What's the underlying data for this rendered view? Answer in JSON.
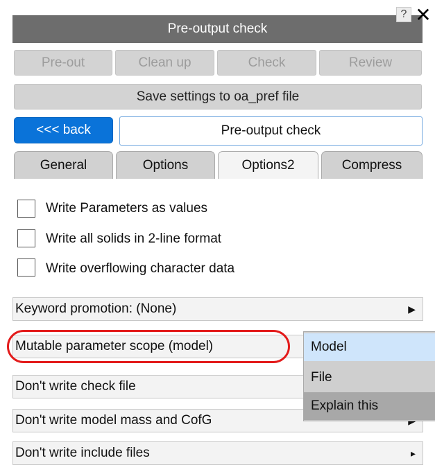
{
  "window": {
    "title": "Pre-output check",
    "help_label": "?",
    "close_label": "✕"
  },
  "toolbar": {
    "buttons": [
      {
        "label": "Pre-out"
      },
      {
        "label": "Clean up"
      },
      {
        "label": "Check"
      },
      {
        "label": "Review"
      }
    ],
    "save_label": "Save settings to oa_pref file"
  },
  "nav": {
    "back_label": "<<< back",
    "current_label": "Pre-output check"
  },
  "tabs": [
    {
      "label": "General",
      "active": false
    },
    {
      "label": "Options",
      "active": false
    },
    {
      "label": "Options2",
      "active": true
    },
    {
      "label": "Compress",
      "active": false
    }
  ],
  "options": [
    {
      "label": "Write Parameters as values",
      "checked": false
    },
    {
      "label": "Write all solids in 2-line format",
      "checked": false
    },
    {
      "label": "Write overflowing character data",
      "checked": false
    }
  ],
  "menu_rows": [
    {
      "label": "Keyword promotion: (None)",
      "arrow": "▶"
    },
    {
      "label": "Mutable parameter scope (model)",
      "arrow": ""
    },
    {
      "label": "Don't write check file",
      "arrow": ""
    },
    {
      "label": "Don't write model mass and CofG",
      "arrow": "▶"
    },
    {
      "label": "Don't write include files",
      "arrow": "▸"
    }
  ],
  "dropdown": {
    "items": [
      {
        "label": "Model",
        "selected": true
      },
      {
        "label": "File",
        "selected": false
      },
      {
        "label": "Explain this",
        "selected": false
      }
    ]
  },
  "colors": {
    "title_bar": "#6d6d6d",
    "back_button": "#0a73d9",
    "highlight": "#e31b1b",
    "selected_item": "#cfe5fb"
  }
}
